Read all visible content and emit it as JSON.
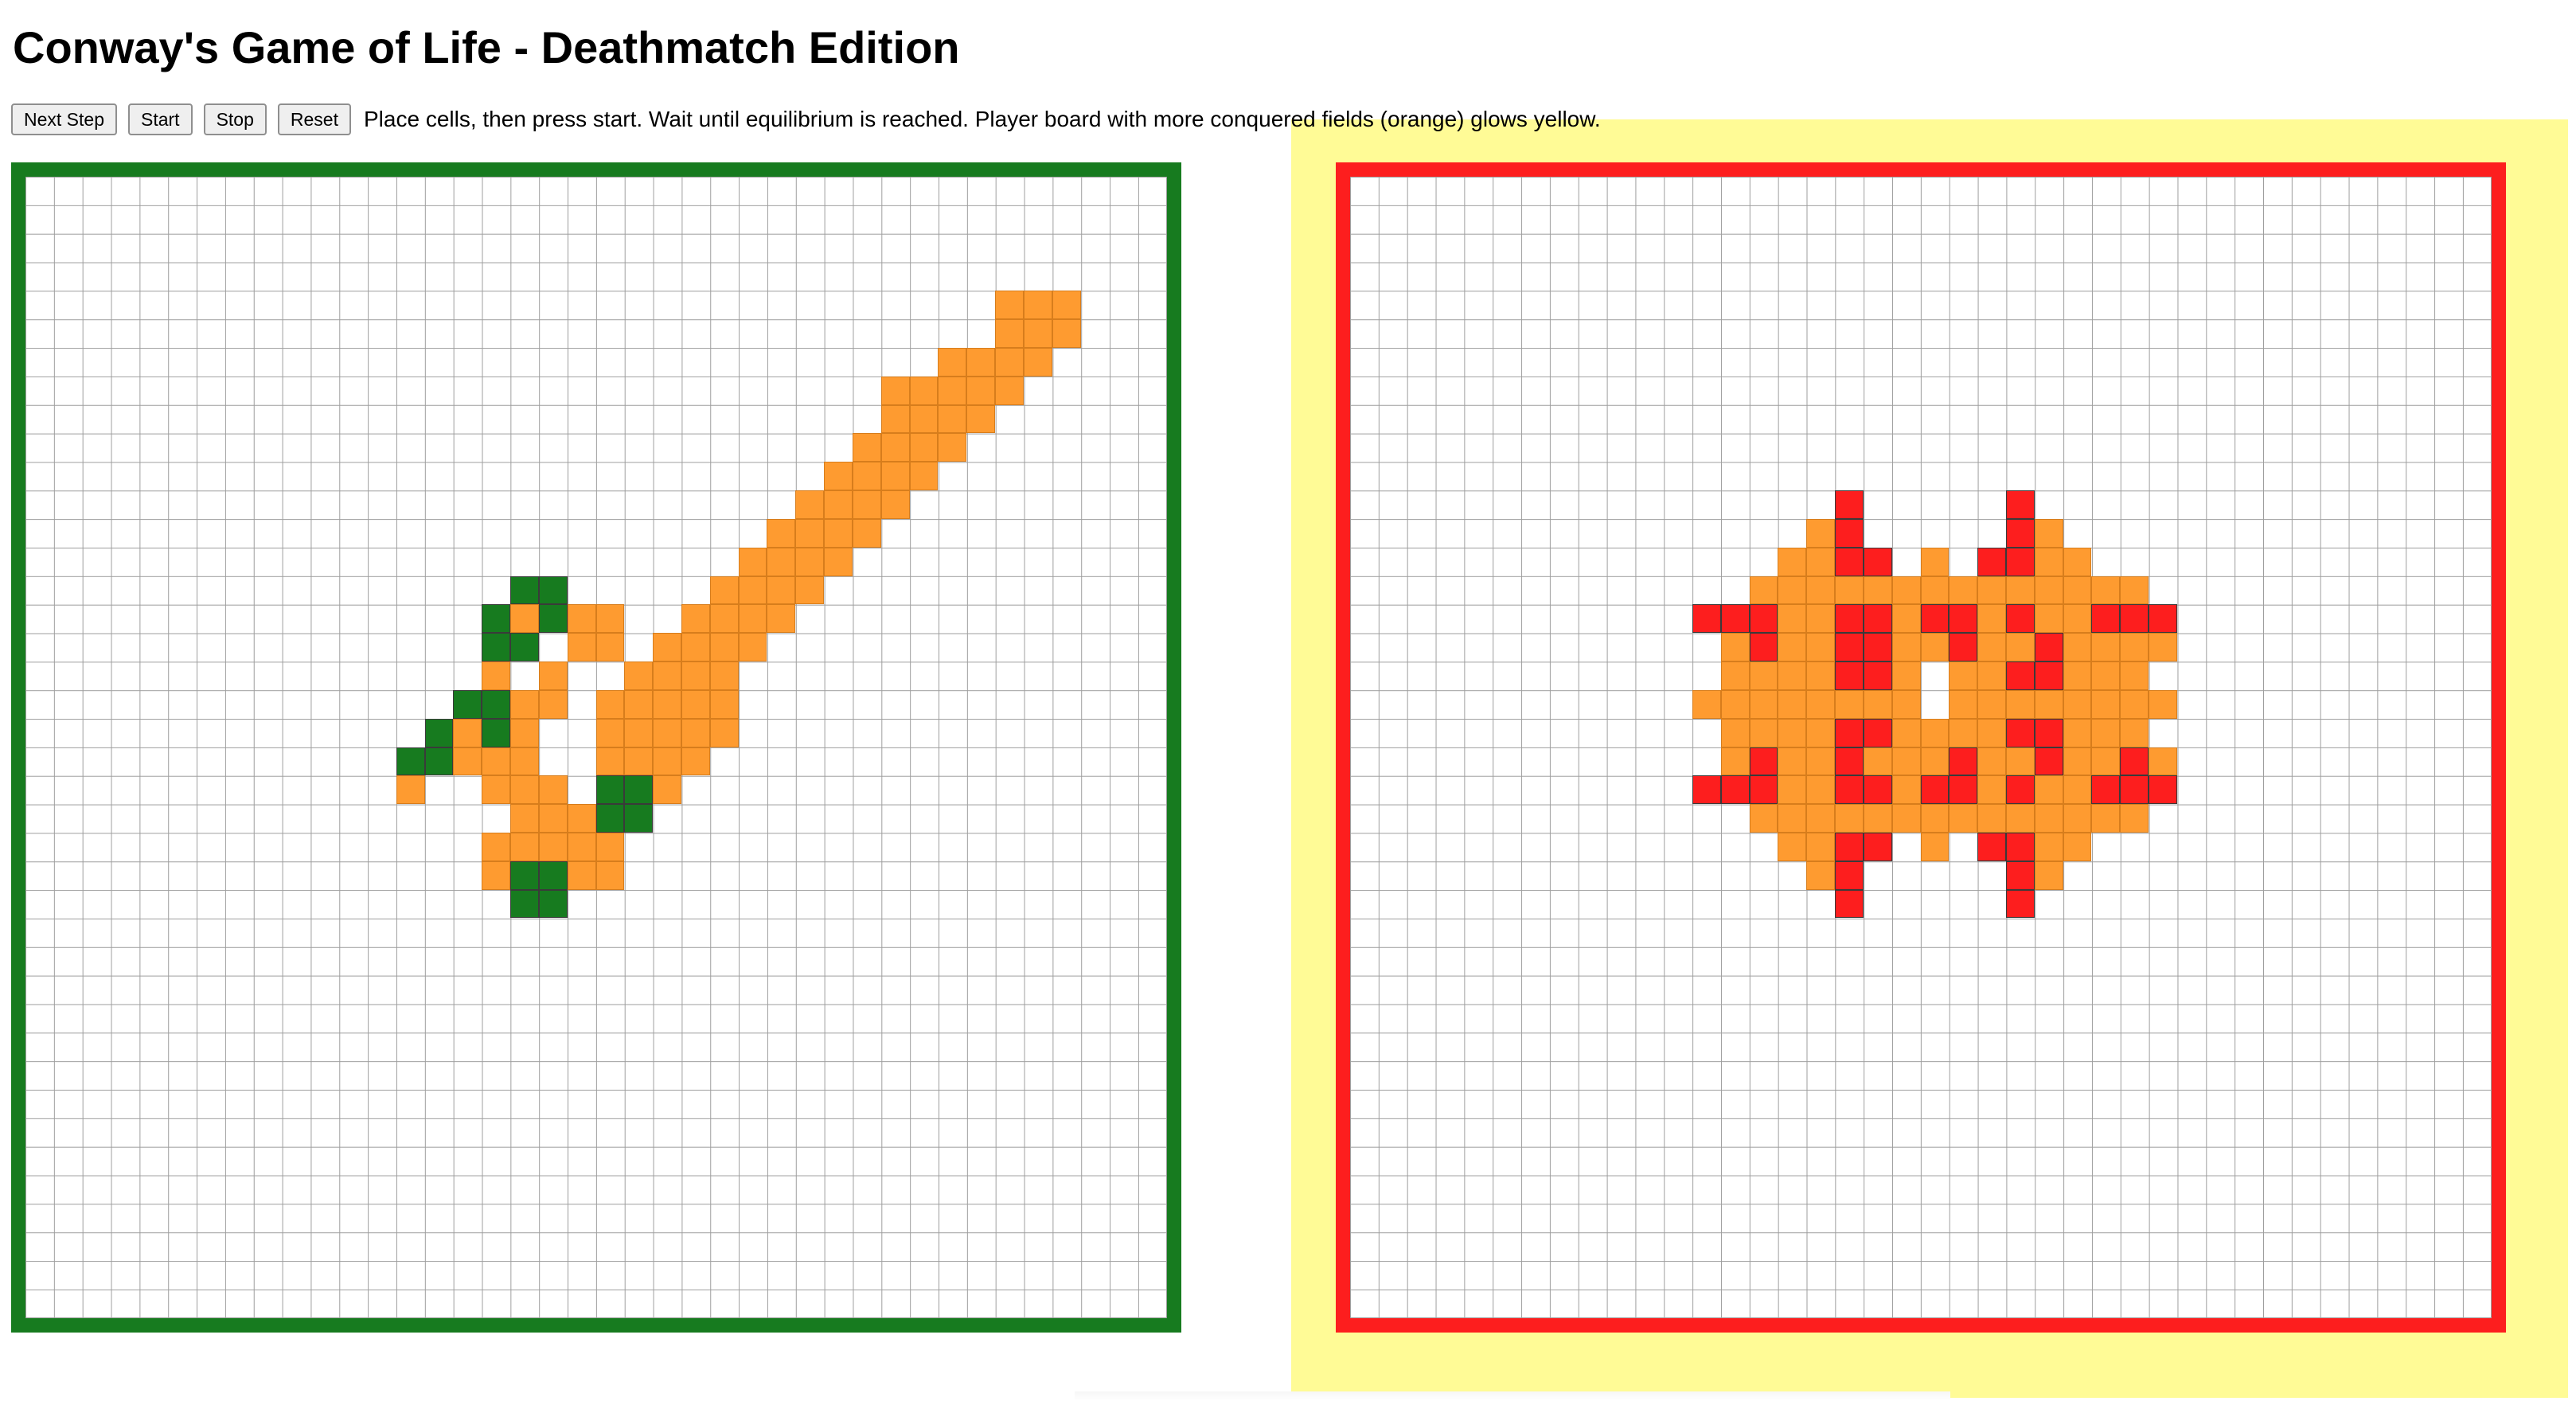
{
  "title": "Conway's Game of Life - Deathmatch Edition",
  "controls": {
    "next_step_label": "Next Step",
    "start_label": "Start",
    "stop_label": "Stop",
    "reset_label": "Reset",
    "instructions": "Place cells, then press start. Wait until equilibrium is reached. Player board with more conquered fields (orange) glows yellow."
  },
  "colors": {
    "glow": "#fffb96",
    "conquered": "#fe9b30",
    "player_left": "#177b1f",
    "player_right": "#fd1e1e"
  },
  "grid_size": 40,
  "boards": [
    {
      "player": "left",
      "glowing": false,
      "border_color": "#177b1f",
      "live_color": "#177b1f",
      "conquered": [
        [
          34,
          4
        ],
        [
          35,
          4
        ],
        [
          36,
          4
        ],
        [
          34,
          5
        ],
        [
          35,
          5
        ],
        [
          36,
          5
        ],
        [
          32,
          6
        ],
        [
          33,
          6
        ],
        [
          34,
          6
        ],
        [
          35,
          6
        ],
        [
          30,
          7
        ],
        [
          31,
          7
        ],
        [
          32,
          7
        ],
        [
          33,
          7
        ],
        [
          34,
          7
        ],
        [
          30,
          8
        ],
        [
          31,
          8
        ],
        [
          32,
          8
        ],
        [
          33,
          8
        ],
        [
          29,
          9
        ],
        [
          30,
          9
        ],
        [
          31,
          9
        ],
        [
          32,
          9
        ],
        [
          28,
          10
        ],
        [
          29,
          10
        ],
        [
          30,
          10
        ],
        [
          31,
          10
        ],
        [
          27,
          11
        ],
        [
          28,
          11
        ],
        [
          29,
          11
        ],
        [
          30,
          11
        ],
        [
          26,
          12
        ],
        [
          27,
          12
        ],
        [
          28,
          12
        ],
        [
          29,
          12
        ],
        [
          25,
          13
        ],
        [
          26,
          13
        ],
        [
          27,
          13
        ],
        [
          28,
          13
        ],
        [
          24,
          14
        ],
        [
          25,
          14
        ],
        [
          26,
          14
        ],
        [
          27,
          14
        ],
        [
          23,
          15
        ],
        [
          24,
          15
        ],
        [
          25,
          15
        ],
        [
          26,
          15
        ],
        [
          22,
          16
        ],
        [
          23,
          16
        ],
        [
          24,
          16
        ],
        [
          25,
          16
        ],
        [
          22,
          17
        ],
        [
          23,
          17
        ],
        [
          24,
          17
        ],
        [
          17,
          15
        ],
        [
          19,
          15
        ],
        [
          20,
          15
        ],
        [
          19,
          16
        ],
        [
          20,
          16
        ],
        [
          16,
          17
        ],
        [
          18,
          17
        ],
        [
          21,
          17
        ],
        [
          23,
          17
        ],
        [
          16,
          18
        ],
        [
          17,
          18
        ],
        [
          18,
          18
        ],
        [
          20,
          18
        ],
        [
          21,
          18
        ],
        [
          22,
          18
        ],
        [
          23,
          18
        ],
        [
          24,
          18
        ],
        [
          15,
          19
        ],
        [
          16,
          19
        ],
        [
          17,
          19
        ],
        [
          20,
          19
        ],
        [
          21,
          19
        ],
        [
          22,
          19
        ],
        [
          23,
          19
        ],
        [
          24,
          19
        ],
        [
          15,
          20
        ],
        [
          16,
          20
        ],
        [
          17,
          20
        ],
        [
          20,
          20
        ],
        [
          21,
          20
        ],
        [
          22,
          20
        ],
        [
          23,
          20
        ],
        [
          13,
          21
        ],
        [
          16,
          21
        ],
        [
          17,
          21
        ],
        [
          18,
          21
        ],
        [
          21,
          21
        ],
        [
          22,
          21
        ],
        [
          17,
          22
        ],
        [
          18,
          22
        ],
        [
          19,
          22
        ],
        [
          20,
          22
        ],
        [
          16,
          23
        ],
        [
          17,
          23
        ],
        [
          18,
          23
        ],
        [
          19,
          23
        ],
        [
          20,
          23
        ],
        [
          16,
          24
        ],
        [
          17,
          24
        ],
        [
          18,
          24
        ],
        [
          19,
          24
        ],
        [
          20,
          24
        ]
      ],
      "live": [
        [
          17,
          14
        ],
        [
          18,
          14
        ],
        [
          16,
          15
        ],
        [
          18,
          15
        ],
        [
          16,
          16
        ],
        [
          17,
          16
        ],
        [
          15,
          18
        ],
        [
          16,
          18
        ],
        [
          14,
          19
        ],
        [
          16,
          19
        ],
        [
          13,
          20
        ],
        [
          14,
          20
        ],
        [
          20,
          21
        ],
        [
          21,
          21
        ],
        [
          20,
          22
        ],
        [
          21,
          22
        ],
        [
          17,
          24
        ],
        [
          18,
          24
        ],
        [
          17,
          25
        ],
        [
          18,
          25
        ]
      ]
    },
    {
      "player": "right",
      "glowing": true,
      "border_color": "#fd1e1e",
      "live_color": "#fd1e1e",
      "conquered": [
        [
          16,
          12
        ],
        [
          17,
          12
        ],
        [
          23,
          12
        ],
        [
          24,
          12
        ],
        [
          15,
          13
        ],
        [
          16,
          13
        ],
        [
          17,
          13
        ],
        [
          18,
          13
        ],
        [
          20,
          13
        ],
        [
          22,
          13
        ],
        [
          23,
          13
        ],
        [
          24,
          13
        ],
        [
          25,
          13
        ],
        [
          14,
          14
        ],
        [
          15,
          14
        ],
        [
          16,
          14
        ],
        [
          17,
          14
        ],
        [
          18,
          14
        ],
        [
          19,
          14
        ],
        [
          20,
          14
        ],
        [
          21,
          14
        ],
        [
          22,
          14
        ],
        [
          23,
          14
        ],
        [
          24,
          14
        ],
        [
          25,
          14
        ],
        [
          26,
          14
        ],
        [
          27,
          14
        ],
        [
          13,
          15
        ],
        [
          14,
          15
        ],
        [
          15,
          15
        ],
        [
          16,
          15
        ],
        [
          17,
          15
        ],
        [
          18,
          15
        ],
        [
          19,
          15
        ],
        [
          20,
          15
        ],
        [
          21,
          15
        ],
        [
          22,
          15
        ],
        [
          23,
          15
        ],
        [
          24,
          15
        ],
        [
          25,
          15
        ],
        [
          26,
          15
        ],
        [
          27,
          15
        ],
        [
          28,
          15
        ],
        [
          13,
          16
        ],
        [
          14,
          16
        ],
        [
          15,
          16
        ],
        [
          16,
          16
        ],
        [
          17,
          16
        ],
        [
          18,
          16
        ],
        [
          19,
          16
        ],
        [
          20,
          16
        ],
        [
          21,
          16
        ],
        [
          22,
          16
        ],
        [
          23,
          16
        ],
        [
          24,
          16
        ],
        [
          25,
          16
        ],
        [
          26,
          16
        ],
        [
          27,
          16
        ],
        [
          28,
          16
        ],
        [
          13,
          17
        ],
        [
          14,
          17
        ],
        [
          15,
          17
        ],
        [
          16,
          17
        ],
        [
          17,
          17
        ],
        [
          18,
          17
        ],
        [
          19,
          17
        ],
        [
          21,
          17
        ],
        [
          22,
          17
        ],
        [
          23,
          17
        ],
        [
          24,
          17
        ],
        [
          25,
          17
        ],
        [
          26,
          17
        ],
        [
          27,
          17
        ],
        [
          12,
          18
        ],
        [
          13,
          18
        ],
        [
          14,
          18
        ],
        [
          15,
          18
        ],
        [
          16,
          18
        ],
        [
          17,
          18
        ],
        [
          18,
          18
        ],
        [
          19,
          18
        ],
        [
          21,
          18
        ],
        [
          22,
          18
        ],
        [
          23,
          18
        ],
        [
          24,
          18
        ],
        [
          25,
          18
        ],
        [
          26,
          18
        ],
        [
          27,
          18
        ],
        [
          28,
          18
        ],
        [
          13,
          19
        ],
        [
          14,
          19
        ],
        [
          15,
          19
        ],
        [
          16,
          19
        ],
        [
          17,
          19
        ],
        [
          18,
          19
        ],
        [
          19,
          19
        ],
        [
          20,
          19
        ],
        [
          21,
          19
        ],
        [
          22,
          19
        ],
        [
          23,
          19
        ],
        [
          24,
          19
        ],
        [
          25,
          19
        ],
        [
          26,
          19
        ],
        [
          27,
          19
        ],
        [
          13,
          20
        ],
        [
          14,
          20
        ],
        [
          15,
          20
        ],
        [
          16,
          20
        ],
        [
          17,
          20
        ],
        [
          18,
          20
        ],
        [
          19,
          20
        ],
        [
          20,
          20
        ],
        [
          21,
          20
        ],
        [
          22,
          20
        ],
        [
          23,
          20
        ],
        [
          24,
          20
        ],
        [
          25,
          20
        ],
        [
          26,
          20
        ],
        [
          27,
          20
        ],
        [
          28,
          20
        ],
        [
          13,
          21
        ],
        [
          14,
          21
        ],
        [
          15,
          21
        ],
        [
          16,
          21
        ],
        [
          17,
          21
        ],
        [
          18,
          21
        ],
        [
          19,
          21
        ],
        [
          20,
          21
        ],
        [
          21,
          21
        ],
        [
          22,
          21
        ],
        [
          23,
          21
        ],
        [
          24,
          21
        ],
        [
          25,
          21
        ],
        [
          26,
          21
        ],
        [
          27,
          21
        ],
        [
          28,
          21
        ],
        [
          14,
          22
        ],
        [
          15,
          22
        ],
        [
          16,
          22
        ],
        [
          17,
          22
        ],
        [
          18,
          22
        ],
        [
          19,
          22
        ],
        [
          20,
          22
        ],
        [
          21,
          22
        ],
        [
          22,
          22
        ],
        [
          23,
          22
        ],
        [
          24,
          22
        ],
        [
          25,
          22
        ],
        [
          26,
          22
        ],
        [
          27,
          22
        ],
        [
          15,
          23
        ],
        [
          16,
          23
        ],
        [
          17,
          23
        ],
        [
          18,
          23
        ],
        [
          20,
          23
        ],
        [
          22,
          23
        ],
        [
          23,
          23
        ],
        [
          24,
          23
        ],
        [
          25,
          23
        ],
        [
          16,
          24
        ],
        [
          17,
          24
        ],
        [
          23,
          24
        ],
        [
          24,
          24
        ]
      ],
      "live": [
        [
          17,
          11
        ],
        [
          23,
          11
        ],
        [
          17,
          12
        ],
        [
          23,
          12
        ],
        [
          17,
          13
        ],
        [
          18,
          13
        ],
        [
          22,
          13
        ],
        [
          23,
          13
        ],
        [
          12,
          15
        ],
        [
          13,
          15
        ],
        [
          14,
          15
        ],
        [
          17,
          15
        ],
        [
          18,
          15
        ],
        [
          20,
          15
        ],
        [
          21,
          15
        ],
        [
          23,
          15
        ],
        [
          26,
          15
        ],
        [
          27,
          15
        ],
        [
          28,
          15
        ],
        [
          14,
          16
        ],
        [
          17,
          16
        ],
        [
          18,
          16
        ],
        [
          21,
          16
        ],
        [
          24,
          16
        ],
        [
          17,
          17
        ],
        [
          18,
          17
        ],
        [
          23,
          17
        ],
        [
          24,
          17
        ],
        [
          17,
          19
        ],
        [
          18,
          19
        ],
        [
          23,
          19
        ],
        [
          24,
          19
        ],
        [
          14,
          20
        ],
        [
          17,
          20
        ],
        [
          21,
          20
        ],
        [
          24,
          20
        ],
        [
          27,
          20
        ],
        [
          12,
          21
        ],
        [
          13,
          21
        ],
        [
          14,
          21
        ],
        [
          17,
          21
        ],
        [
          18,
          21
        ],
        [
          20,
          21
        ],
        [
          21,
          21
        ],
        [
          23,
          21
        ],
        [
          26,
          21
        ],
        [
          27,
          21
        ],
        [
          28,
          21
        ],
        [
          17,
          23
        ],
        [
          18,
          23
        ],
        [
          22,
          23
        ],
        [
          23,
          23
        ],
        [
          17,
          24
        ],
        [
          23,
          24
        ],
        [
          17,
          25
        ],
        [
          23,
          25
        ]
      ]
    }
  ]
}
